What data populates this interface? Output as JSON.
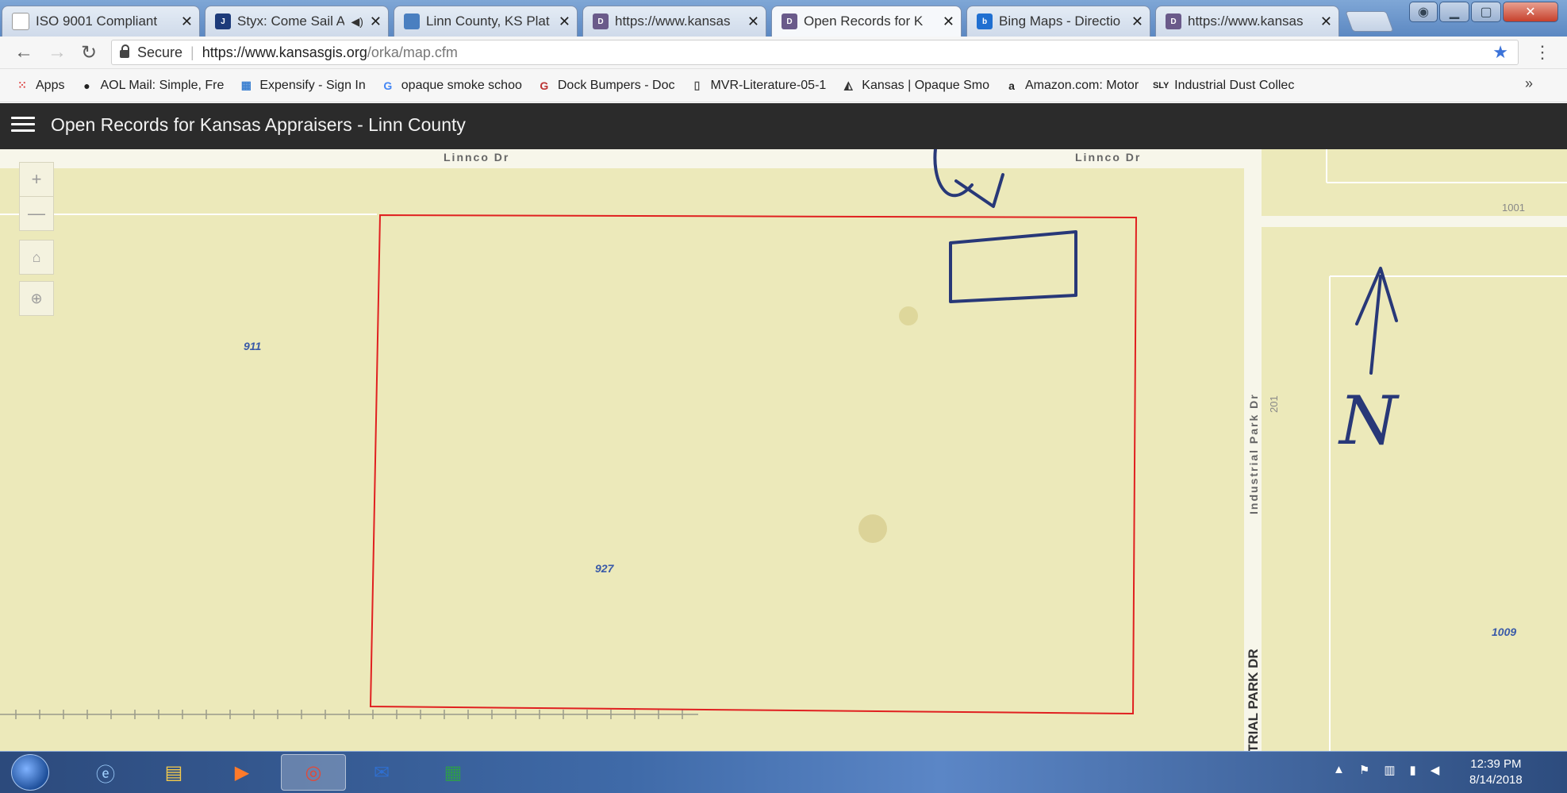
{
  "browser": {
    "tabs": [
      {
        "title": "ISO 9001 Compliant",
        "favicon": "page-icon",
        "active": false
      },
      {
        "title": "Styx: Come Sail A",
        "favicon": "j-icon",
        "audio": true,
        "active": false
      },
      {
        "title": "Linn County, KS Plat",
        "favicon": "plat-icon",
        "active": false
      },
      {
        "title": "https://www.kansas",
        "favicon": "dasc-icon",
        "active": false
      },
      {
        "title": "Open Records for K",
        "favicon": "dasc-icon",
        "active": true
      },
      {
        "title": "Bing Maps - Directio",
        "favicon": "bing-icon",
        "active": false
      },
      {
        "title": "https://www.kansas",
        "favicon": "dasc-icon",
        "active": false
      }
    ],
    "close_glyph": "✕",
    "address": {
      "secure_label": "Secure",
      "url_domain": "https://www.kansasgis.org",
      "url_path": "/orka/map.cfm"
    },
    "bookmarks": [
      {
        "label": "Apps",
        "icon": "apps-grid-icon"
      },
      {
        "label": "AOL Mail: Simple, Fre",
        "icon": "aol-icon"
      },
      {
        "label": "Expensify - Sign In",
        "icon": "expensify-icon"
      },
      {
        "label": "opaque smoke schoo",
        "icon": "google-icon"
      },
      {
        "label": "Dock Bumpers - Doc",
        "icon": "g-icon"
      },
      {
        "label": "MVR-Literature-05-1",
        "icon": "page-icon"
      },
      {
        "label": "Kansas | Opaque Smo",
        "icon": "kansas-icon"
      },
      {
        "label": "Amazon.com: Motor",
        "icon": "amazon-icon"
      },
      {
        "label": "Industrial Dust Collec",
        "icon": "sly-icon"
      }
    ],
    "bookmarks_more": "»"
  },
  "app": {
    "title": "Open Records for Kansas Appraisers - Linn County"
  },
  "map": {
    "controls": {
      "zoom_in": "+",
      "zoom_out": "—"
    },
    "streets": {
      "top_left": "Linnco Dr",
      "top_right": "Linnco Dr",
      "vertical": "Industrial Park Dr",
      "vertical_cut": "TRIAL PARK DR"
    },
    "parcels": {
      "p911": "911",
      "p927": "927",
      "p1009": "1009"
    },
    "addresses": {
      "a1001": "1001",
      "a201": "201"
    },
    "annotation_text": "N",
    "selection_color": "#e02020",
    "ink_color": "#283878"
  },
  "taskbar": {
    "time": "12:39 PM",
    "date": "8/14/2018"
  }
}
